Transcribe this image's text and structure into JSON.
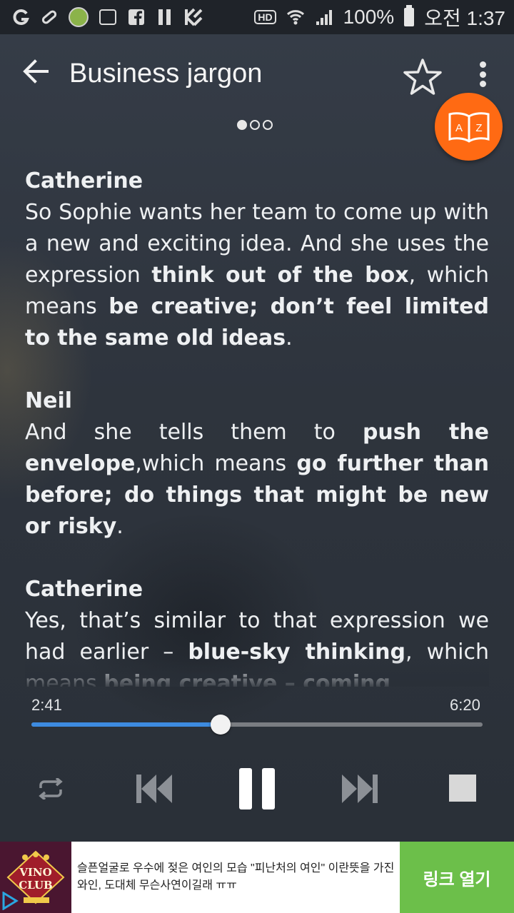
{
  "status_bar": {
    "battery_text": "100%",
    "time_text": "오전 1:37",
    "hd_label": "HD"
  },
  "toolbar": {
    "title": "Business jargon"
  },
  "pager": {
    "pages": 3,
    "active_index": 0
  },
  "az_button": {
    "letter_a": "A",
    "letter_z": "Z"
  },
  "transcript": [
    {
      "speaker": "Catherine",
      "runs": [
        {
          "t": "So Sophie wants her team to come up with a new and exciting idea. And she uses the expression ",
          "b": false
        },
        {
          "t": "think out of the box",
          "b": true
        },
        {
          "t": ", which means ",
          "b": false
        },
        {
          "t": "be creative; don’t feel limited to the same old ideas",
          "b": true
        },
        {
          "t": ".",
          "b": false
        }
      ]
    },
    {
      "speaker": "Neil",
      "runs": [
        {
          "t": "And she tells them to ",
          "b": false
        },
        {
          "t": "push the envelope",
          "b": true
        },
        {
          "t": ",which means ",
          "b": false
        },
        {
          "t": "go further than before; do things that might be new or risky",
          "b": true
        },
        {
          "t": ".",
          "b": false
        }
      ]
    },
    {
      "speaker": "Catherine",
      "runs": [
        {
          "t": "Yes, that’s similar to that expression we had earlier – ",
          "b": false
        },
        {
          "t": "blue-sky thinking",
          "b": true
        },
        {
          "t": ", which means ",
          "b": false
        },
        {
          "t": "being creative – coming",
          "b": true
        }
      ]
    }
  ],
  "player": {
    "current_time": "2:41",
    "total_time": "6:20",
    "progress": 0.42
  },
  "ad": {
    "logo_line1": "VINO",
    "logo_line2": "CLUB",
    "text": "슬픈얼굴로 우수에 젖은 여인의 모습 \"피난처의 여인\" 이란뜻을 가진 와인, 도대체 무슨사연이길래 ㅠㅠ",
    "cta": "링크 열기"
  },
  "colors": {
    "accent_orange": "#ff6a13",
    "seek_blue": "#3d8be0",
    "ad_green": "#6cbf4a"
  },
  "icons": [
    "back-arrow-icon",
    "star-outline-icon",
    "more-vert-icon",
    "dictionary-az-icon",
    "repeat-icon",
    "skip-previous-icon",
    "pause-icon",
    "skip-next-icon",
    "stop-icon"
  ]
}
